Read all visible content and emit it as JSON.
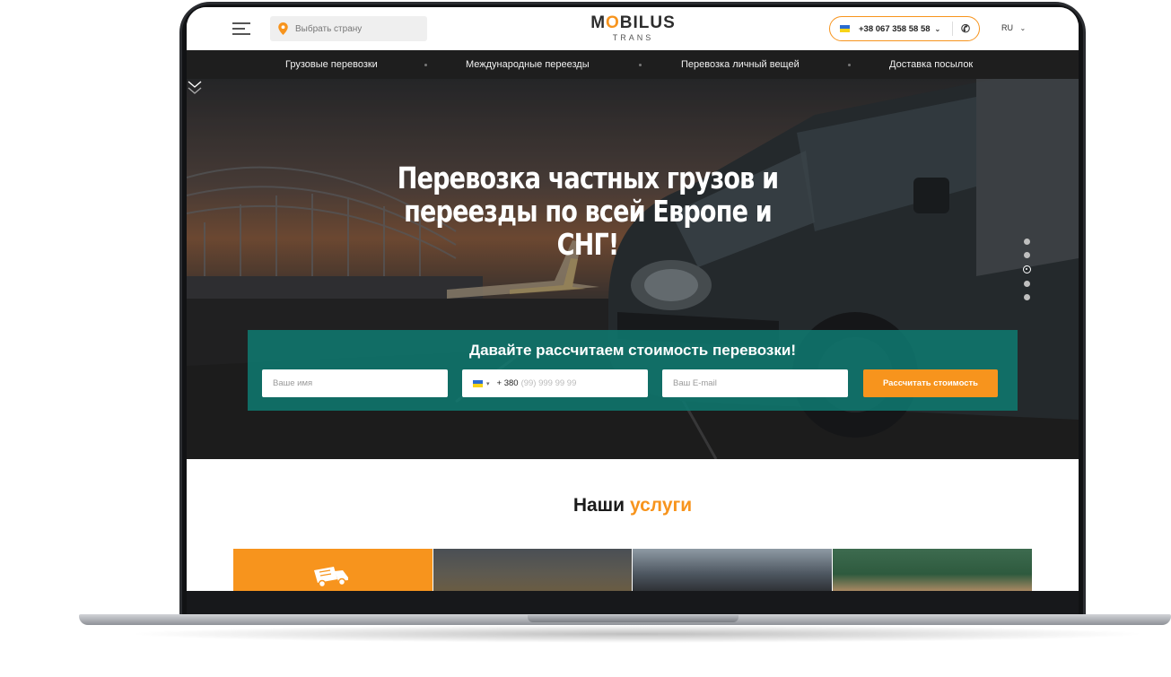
{
  "header": {
    "country_placeholder": "Выбрать страну",
    "logo_text_1": "M",
    "logo_text_o": "O",
    "logo_text_2": "BILUS",
    "logo_sub": "TRANS",
    "phone": "+38 067 358 58 58",
    "lang": "RU"
  },
  "nav": {
    "items": [
      {
        "label": "Грузовые перевозки"
      },
      {
        "label": "Международные переезды"
      },
      {
        "label": "Перевозка личный вещей"
      },
      {
        "label": "Доставка посылок"
      }
    ]
  },
  "hero": {
    "title_line1": "Перевозка частных грузов и",
    "title_line2": "переезды по всей Европе и СНГ!",
    "slides_count": 5,
    "active_slide": 3
  },
  "calc": {
    "title": "Давайте рассчитаем стоимость перевозки!",
    "name_placeholder": "Ваше имя",
    "phone_code": "+ 380",
    "phone_placeholder": "(99) 999 99 99",
    "email_placeholder": "Ваш E-mail",
    "submit_label": "Рассчитать стоимость"
  },
  "services": {
    "title_main": "Наши",
    "title_accent": "услуги"
  },
  "colors": {
    "accent": "#f7941d",
    "nav_bg": "#1e1e1e",
    "calc_bg": "#0f786e"
  }
}
